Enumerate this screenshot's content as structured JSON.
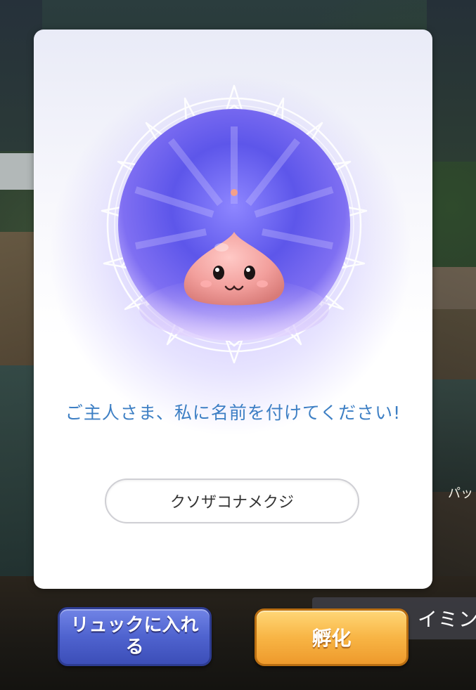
{
  "background": {
    "side_text": "パッ",
    "side_label": "イミン"
  },
  "dialog": {
    "message": "ご主人さま、私に名前を付けてください!",
    "name_field_value": "クソザコナメクジ"
  },
  "buttons": {
    "bag_label": "リュックに入れる",
    "hatch_label": "孵化"
  },
  "colors": {
    "message_text": "#3d7fc4",
    "bag_button": "#4f63cf",
    "hatch_button": "#f8b545",
    "orb_core": "#6a5cf0"
  },
  "icons": {
    "pet": "poring-pet-icon",
    "orb": "crystal-orb-icon"
  }
}
